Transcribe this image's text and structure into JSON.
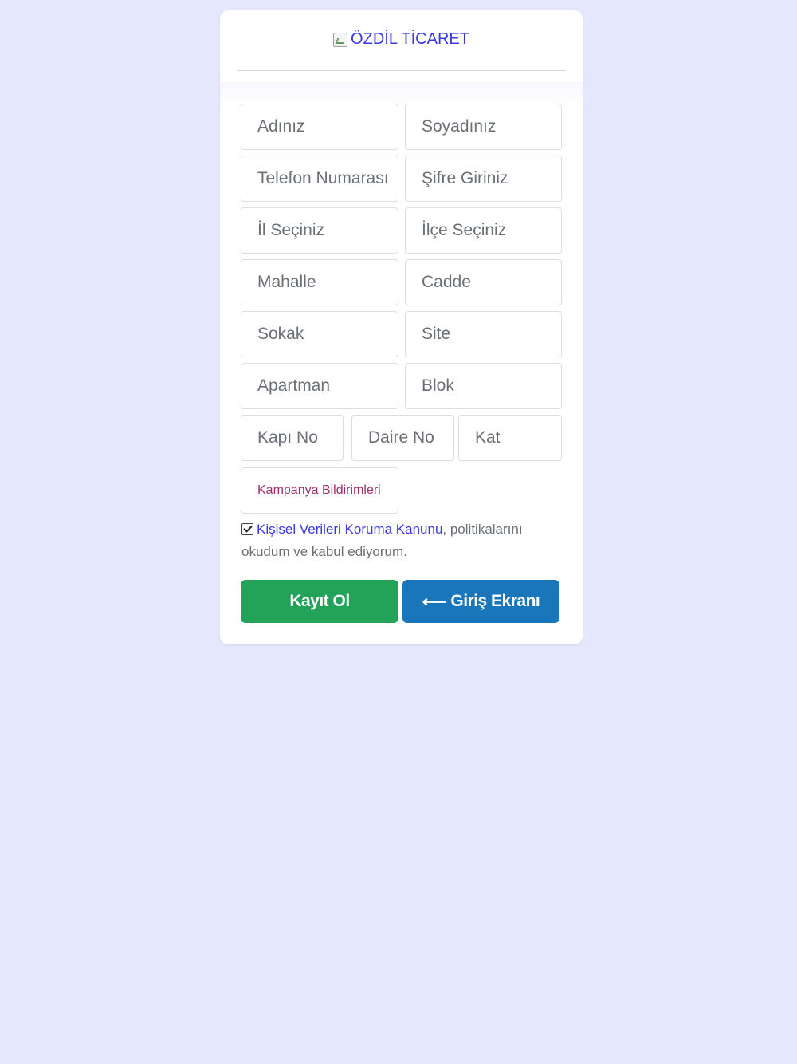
{
  "header": {
    "logo_alt": "ÖZDİL TİCARET",
    "logo_icon": "broken-image-icon"
  },
  "form": {
    "first_name": {
      "placeholder": "Adınız"
    },
    "last_name": {
      "placeholder": "Soyadınız"
    },
    "phone": {
      "placeholder": "Telefon Numarası"
    },
    "password": {
      "placeholder": "Şifre Giriniz"
    },
    "province": {
      "selected": "İl Seçiniz"
    },
    "district": {
      "selected": "İlçe Seçiniz"
    },
    "neighborhood": {
      "placeholder": "Mahalle"
    },
    "street": {
      "placeholder": "Cadde"
    },
    "lane": {
      "placeholder": "Sokak"
    },
    "site": {
      "placeholder": "Site"
    },
    "apartment": {
      "placeholder": "Apartman"
    },
    "block": {
      "placeholder": "Blok"
    },
    "door_no": {
      "placeholder": "Kapı No"
    },
    "flat_no": {
      "placeholder": "Daire No"
    },
    "floor": {
      "placeholder": "Kat"
    },
    "campaign": {
      "selected": "Kampanya Bildirimleri"
    }
  },
  "consent": {
    "checked": true,
    "link_text": "Kişisel Verileri Koruma Kanunu",
    "rest_text": ", politikalarını okudum ve kabul ediyorum."
  },
  "buttons": {
    "register_label": "Kayıt Ol",
    "login_arrow": "⟵",
    "login_label": "Giriş Ekranı"
  },
  "colors": {
    "background": "#e5e7fd",
    "link": "#3a3ae0",
    "register": "#23a35a",
    "login": "#1976bb",
    "campaign_text": "#a0306a"
  }
}
